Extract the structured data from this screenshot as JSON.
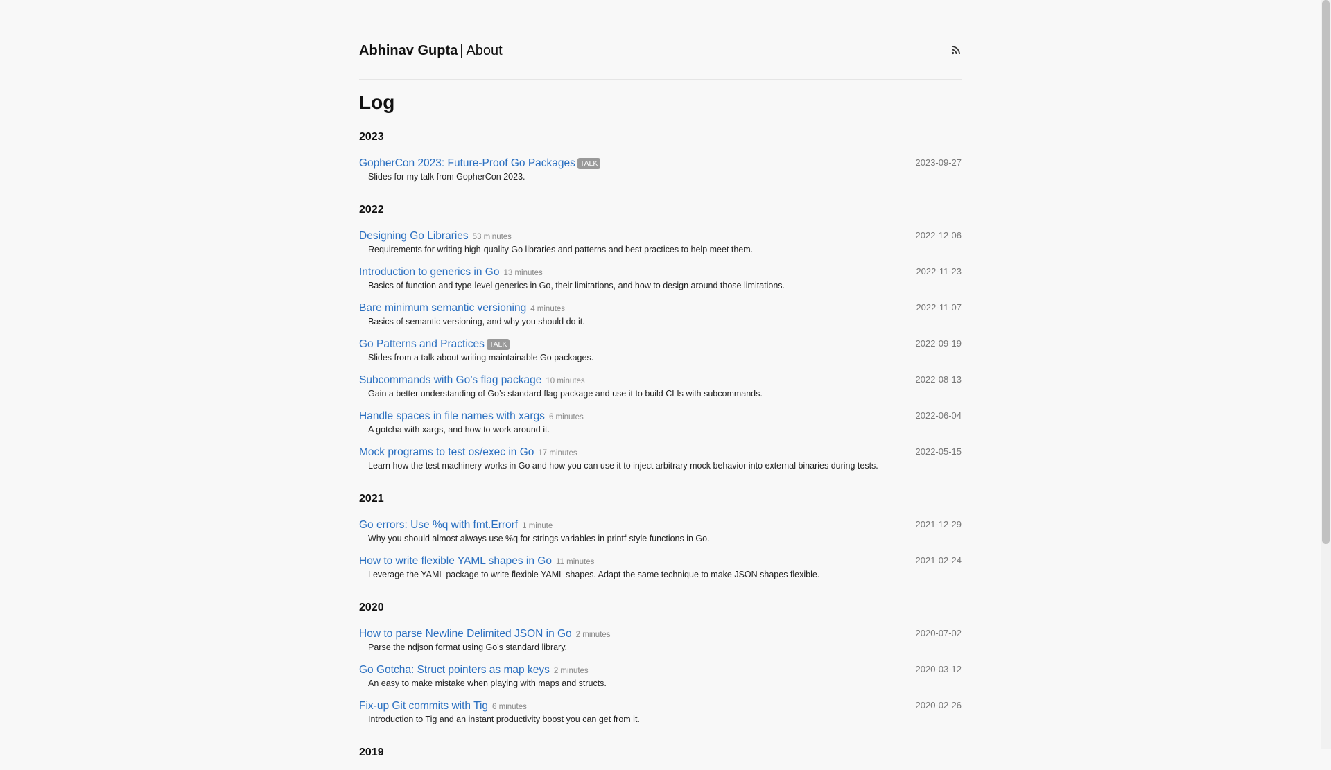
{
  "header": {
    "author": "Abhinav Gupta",
    "separator": "|",
    "about_link": "About",
    "rss_icon": "rss-icon"
  },
  "page_title": "Log",
  "years": [
    {
      "year": "2023",
      "entries": [
        {
          "title": "GopherCon 2023: Future-Proof Go Packages",
          "tag": "TALK",
          "reading_time": "",
          "description": "Slides for my talk from GopherCon 2023.",
          "date": "2023-09-27"
        }
      ]
    },
    {
      "year": "2022",
      "entries": [
        {
          "title": "Designing Go Libraries",
          "tag": "",
          "reading_time": "53 minutes",
          "description": "Requirements for writing high-quality Go libraries and patterns and best practices to help meet them.",
          "date": "2022-12-06"
        },
        {
          "title": "Introduction to generics in Go",
          "tag": "",
          "reading_time": "13 minutes",
          "description": "Basics of function and type-level generics in Go, their limitations, and how to design around those limitations.",
          "date": "2022-11-23"
        },
        {
          "title": "Bare minimum semantic versioning",
          "tag": "",
          "reading_time": "4 minutes",
          "description": "Basics of semantic versioning, and why you should do it.",
          "date": "2022-11-07"
        },
        {
          "title": "Go Patterns and Practices",
          "tag": "TALK",
          "reading_time": "",
          "description": "Slides from a talk about writing maintainable Go packages.",
          "date": "2022-09-19"
        },
        {
          "title": "Subcommands with Go’s flag package",
          "tag": "",
          "reading_time": "10 minutes",
          "description": "Gain a better understanding of Go’s standard flag package and use it to build CLIs with subcommands.",
          "date": "2022-08-13"
        },
        {
          "title": "Handle spaces in file names with xargs",
          "tag": "",
          "reading_time": "6 minutes",
          "description": "A gotcha with xargs, and how to work around it.",
          "date": "2022-06-04"
        },
        {
          "title": "Mock programs to test os/exec in Go",
          "tag": "",
          "reading_time": "17 minutes",
          "description": "Learn how the test machinery works in Go and how you can use it to inject arbitrary mock behavior into external binaries during tests.",
          "date": "2022-05-15"
        }
      ]
    },
    {
      "year": "2021",
      "entries": [
        {
          "title": "Go errors: Use %q with fmt.Errorf",
          "tag": "",
          "reading_time": "1 minute",
          "description": "Why you should almost always use %q for strings variables in printf-style functions in Go.",
          "date": "2021-12-29"
        },
        {
          "title": "How to write flexible YAML shapes in Go",
          "tag": "",
          "reading_time": "11 minutes",
          "description": "Leverage the YAML package to write flexible YAML shapes. Adapt the same technique to make JSON shapes flexible.",
          "date": "2021-02-24"
        }
      ]
    },
    {
      "year": "2020",
      "entries": [
        {
          "title": "How to parse Newline Delimited JSON in Go",
          "tag": "",
          "reading_time": "2 minutes",
          "description": "Parse the ndjson format using Go's standard library.",
          "date": "2020-07-02"
        },
        {
          "title": "Go Gotcha: Struct pointers as map keys",
          "tag": "",
          "reading_time": "2 minutes",
          "description": "An easy to make mistake when playing with maps and structs.",
          "date": "2020-03-12"
        },
        {
          "title": "Fix-up Git commits with Tig",
          "tag": "",
          "reading_time": "6 minutes",
          "description": "Introduction to Tig and an instant productivity boost you can get from it.",
          "date": "2020-02-26"
        }
      ]
    },
    {
      "year": "2019",
      "entries": []
    }
  ]
}
